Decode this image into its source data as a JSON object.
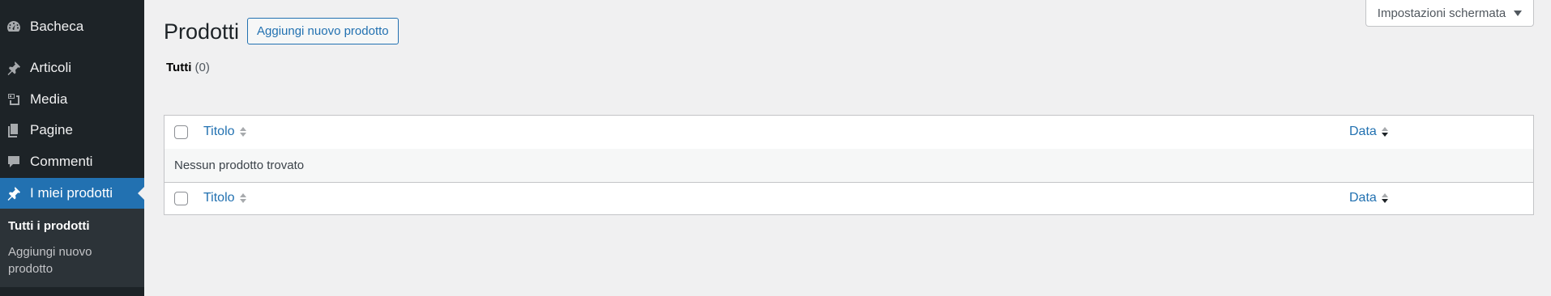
{
  "sidebar": {
    "items": [
      {
        "label": "Bacheca",
        "icon": "dashboard-icon"
      },
      {
        "label": "Articoli",
        "icon": "pin-icon"
      },
      {
        "label": "Media",
        "icon": "media-icon"
      },
      {
        "label": "Pagine",
        "icon": "pages-icon"
      },
      {
        "label": "Commenti",
        "icon": "comments-icon"
      },
      {
        "label": "I miei prodotti",
        "icon": "pin-icon"
      }
    ],
    "submenu": [
      {
        "label": "Tutti i prodotti"
      },
      {
        "label": "Aggiungi nuovo prodotto"
      }
    ]
  },
  "header": {
    "title": "Prodotti",
    "add_new": "Aggiungi nuovo prodotto",
    "screen_options": "Impostazioni schermata"
  },
  "filters": {
    "all_label": "Tutti",
    "all_count": "(0)"
  },
  "table": {
    "columns": {
      "title": "Titolo",
      "date": "Data"
    },
    "empty_message": "Nessun prodotto trovato"
  },
  "colors": {
    "sidebar_bg": "#1d2327",
    "accent": "#2271b1",
    "page_bg": "#f0f0f1"
  }
}
